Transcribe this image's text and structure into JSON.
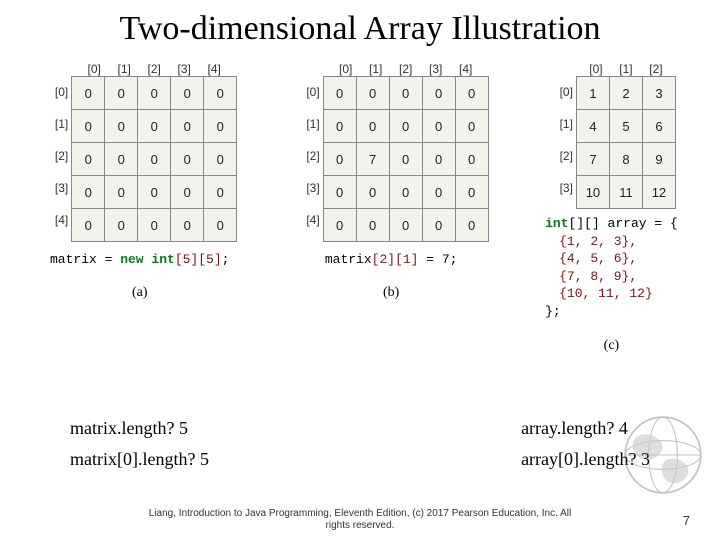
{
  "title": "Two-dimensional Array Illustration",
  "fig_a": {
    "col_headers": [
      "[0]",
      "[1]",
      "[2]",
      "[3]",
      "[4]"
    ],
    "row_headers": [
      "[0]",
      "[1]",
      "[2]",
      "[3]",
      "[4]"
    ],
    "cells": [
      [
        "0",
        "0",
        "0",
        "0",
        "0"
      ],
      [
        "0",
        "0",
        "0",
        "0",
        "0"
      ],
      [
        "0",
        "0",
        "0",
        "0",
        "0"
      ],
      [
        "0",
        "0",
        "0",
        "0",
        "0"
      ],
      [
        "0",
        "0",
        "0",
        "0",
        "0"
      ]
    ],
    "code_prefix": "matrix = ",
    "code_kw": "new int",
    "code_dims": "[5][5]",
    "code_suffix": ";",
    "sublabel": "(a)"
  },
  "fig_b": {
    "col_headers": [
      "[0]",
      "[1]",
      "[2]",
      "[3]",
      "[4]"
    ],
    "row_headers": [
      "[0]",
      "[1]",
      "[2]",
      "[3]",
      "[4]"
    ],
    "cells": [
      [
        "0",
        "0",
        "0",
        "0",
        "0"
      ],
      [
        "0",
        "0",
        "0",
        "0",
        "0"
      ],
      [
        "0",
        "7",
        "0",
        "0",
        "0"
      ],
      [
        "0",
        "0",
        "0",
        "0",
        "0"
      ],
      [
        "0",
        "0",
        "0",
        "0",
        "0"
      ]
    ],
    "code_prefix": "matrix",
    "code_idx1": "[2]",
    "code_idx2": "[1]",
    "code_suffix": " = 7;",
    "sublabel": "(b)"
  },
  "fig_c": {
    "col_headers": [
      "[0]",
      "[1]",
      "[2]"
    ],
    "row_headers": [
      "[0]",
      "[1]",
      "[2]",
      "[3]"
    ],
    "cells": [
      [
        "1",
        "2",
        "3"
      ],
      [
        "4",
        "5",
        "6"
      ],
      [
        "7",
        "8",
        "9"
      ],
      [
        "10",
        "11",
        "12"
      ]
    ],
    "decl_kw": "int",
    "decl_rest": "[][] array = {",
    "rows": [
      "{1,  2,  3},",
      "{4,  5,  6},",
      "{7,  8,  9},",
      "{10, 11, 12}"
    ],
    "close": "};",
    "sublabel": "(c)"
  },
  "bottom": {
    "left1": "matrix.length?  5",
    "left2": "matrix[0].length? 5",
    "right1": "array.length?  4",
    "right2": "array[0].length? 3"
  },
  "footer_line1": "Liang, Introduction to Java Programming, Eleventh Edition, (c) 2017 Pearson Education, Inc. All",
  "footer_line2": "rights reserved.",
  "page_number": "7"
}
